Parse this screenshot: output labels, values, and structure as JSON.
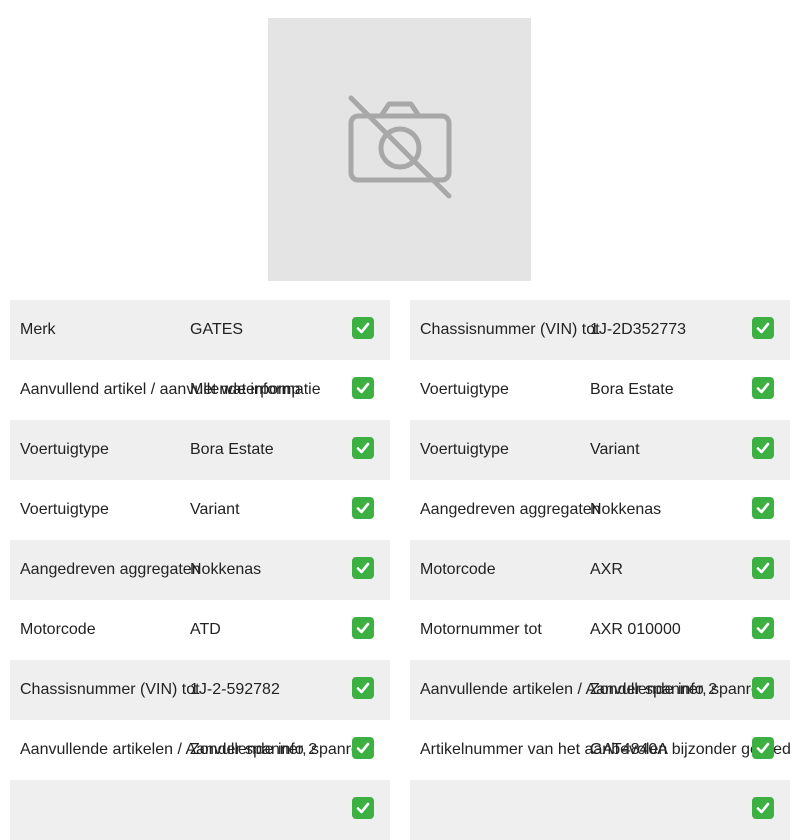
{
  "image": {
    "icon": "no-photo-camera-icon"
  },
  "colors": {
    "row_shade": "#efefef",
    "check": "#3cb043",
    "placeholder_bg": "#e4e4e4"
  },
  "left_rows": [
    {
      "label": "Merk",
      "value": "GATES"
    },
    {
      "label": "Aanvullend artikel / aanvullende informatie",
      "value": "Met waterpomp"
    },
    {
      "label": "Voertuigtype",
      "value": "Bora Estate"
    },
    {
      "label": "Voertuigtype",
      "value": "Variant"
    },
    {
      "label": "Aangedreven aggregaten",
      "value": "Nokkenas"
    },
    {
      "label": "Motorcode",
      "value": "ATD"
    },
    {
      "label": "Chassisnummer (VIN) tot",
      "value": "1J-2-592782"
    },
    {
      "label": "Aanvullende artikelen / Aanvullende info 2",
      "value": "Zonder spanner, spanrol"
    },
    {
      "label": "",
      "value": ""
    }
  ],
  "right_rows": [
    {
      "label": "Chassisnummer (VIN) tot",
      "value": "1J-2D352773"
    },
    {
      "label": "Voertuigtype",
      "value": "Bora Estate"
    },
    {
      "label": "Voertuigtype",
      "value": "Variant"
    },
    {
      "label": "Aangedreven aggregaten",
      "value": "Nokkenas"
    },
    {
      "label": "Motorcode",
      "value": "AXR"
    },
    {
      "label": "Motornummer tot",
      "value": "AXR 010000"
    },
    {
      "label": "Aanvullende artikelen / Aanvullende info 2",
      "value": "Zonder spanner, spanrol"
    },
    {
      "label": "Artikelnummer van het aanbevolen bijzonder gereedschap",
      "value": "GAT4840A"
    },
    {
      "label": "",
      "value": ""
    }
  ]
}
